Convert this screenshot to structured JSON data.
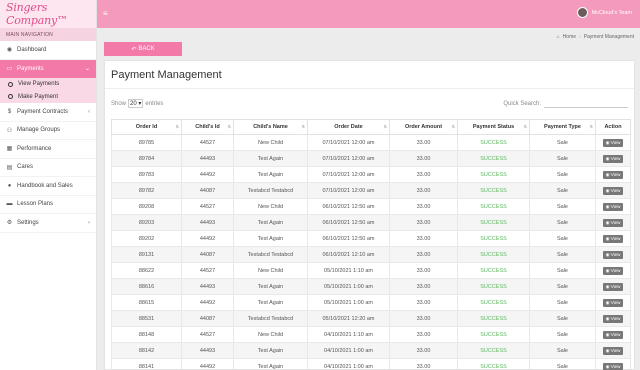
{
  "brand": {
    "logo_text": "Singers Company™"
  },
  "topbar": {
    "menu_icon": "hamburger-icon",
    "user_name": "McCloud's Team"
  },
  "sidebar": {
    "section_label": "MAIN NAVIGATION",
    "items": [
      {
        "label": "Dashboard",
        "icon": "dashboard-icon"
      },
      {
        "label": "Payments",
        "icon": "payments-icon",
        "active": true
      },
      {
        "label": "Payment Contracts",
        "icon": "contract-icon"
      },
      {
        "label": "Manage Groups",
        "icon": "groups-icon"
      },
      {
        "label": "Performance",
        "icon": "performance-icon"
      },
      {
        "label": "Cares",
        "icon": "cares-icon"
      },
      {
        "label": "Handbook and Sales",
        "icon": "handbook-icon"
      },
      {
        "label": "Lesson Plans",
        "icon": "lesson-icon"
      },
      {
        "label": "Settings",
        "icon": "settings-icon"
      }
    ],
    "sub_items": [
      {
        "label": "View Payments"
      },
      {
        "label": "Make Payment"
      }
    ]
  },
  "back_button": {
    "label": "BACK"
  },
  "breadcrumb": {
    "home": "Home",
    "current": "Payment Management"
  },
  "panel": {
    "title": "Payment Management"
  },
  "controls": {
    "show_label": "Show",
    "show_value": "20",
    "entries_label": "entries",
    "search_label": "Quick Search:"
  },
  "table": {
    "columns": [
      "Order Id",
      "Child's Id",
      "Child's Name",
      "Order Date",
      "Order Amount",
      "Payment Status",
      "Payment Type",
      "Action"
    ],
    "rows": [
      [
        "89785",
        "44527",
        "New Child",
        "07/10/2021 12:00 am",
        "33.00",
        "SUCCESS",
        "Sale",
        "View"
      ],
      [
        "89784",
        "44493",
        "Test Again",
        "07/10/2021 12:00 am",
        "33.00",
        "SUCCESS",
        "Sale",
        "View"
      ],
      [
        "89783",
        "44492",
        "Test Again",
        "07/10/2021 12:00 am",
        "33.00",
        "SUCCESS",
        "Sale",
        "View"
      ],
      [
        "89782",
        "44087",
        "Testabcd Testabcd",
        "07/10/2021 12:00 am",
        "33.00",
        "SUCCESS",
        "Sale",
        "View"
      ],
      [
        "89208",
        "44527",
        "New Child",
        "06/10/2021 12:50 am",
        "33.00",
        "SUCCESS",
        "Sale",
        "View"
      ],
      [
        "89203",
        "44493",
        "Test Again",
        "06/10/2021 12:50 am",
        "33.00",
        "SUCCESS",
        "Sale",
        "View"
      ],
      [
        "89202",
        "44492",
        "Test Again",
        "06/10/2021 12:50 am",
        "33.00",
        "SUCCESS",
        "Sale",
        "View"
      ],
      [
        "89131",
        "44087",
        "Testabcd Testabcd",
        "06/10/2021 12:10 am",
        "33.00",
        "SUCCESS",
        "Sale",
        "View"
      ],
      [
        "88622",
        "44527",
        "New Child",
        "05/10/2021 1:10 am",
        "33.00",
        "SUCCESS",
        "Sale",
        "View"
      ],
      [
        "88616",
        "44493",
        "Test Again",
        "05/10/2021 1:00 am",
        "33.00",
        "SUCCESS",
        "Sale",
        "View"
      ],
      [
        "88615",
        "44492",
        "Test Again",
        "05/10/2021 1:00 am",
        "33.00",
        "SUCCESS",
        "Sale",
        "View"
      ],
      [
        "88531",
        "44087",
        "Testabcd Testabcd",
        "05/10/2021 12:20 am",
        "33.00",
        "SUCCESS",
        "Sale",
        "View"
      ],
      [
        "88148",
        "44527",
        "New Child",
        "04/10/2021 1:10 am",
        "33.00",
        "SUCCESS",
        "Sale",
        "View"
      ],
      [
        "88142",
        "44493",
        "Test Again",
        "04/10/2021 1:00 am",
        "33.00",
        "SUCCESS",
        "Sale",
        "View"
      ],
      [
        "88141",
        "44492",
        "Test Again",
        "04/10/2021 1:00 am",
        "33.00",
        "SUCCESS",
        "Sale",
        "View"
      ]
    ]
  },
  "colors": {
    "primary": "#f37aa8",
    "topbar": "#f49bbd",
    "success": "#5cb85c"
  }
}
